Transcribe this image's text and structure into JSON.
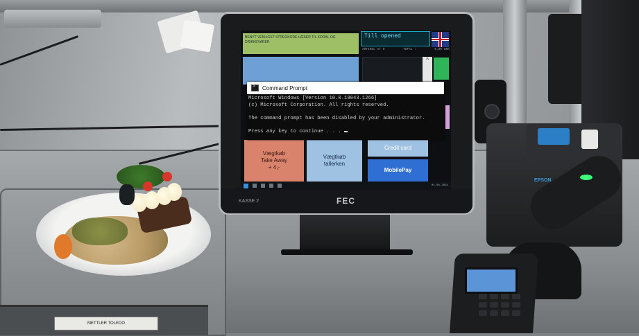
{
  "terminal": {
    "bezel_brand": "FEC",
    "register_label": "KASSE 2"
  },
  "pos": {
    "banner_text": "BENYT VENLIGST STREGKODE LÆSER TIL KODAL OG DRIKKEVARER",
    "till_status": "Till opened",
    "stats": [
      "ARTIKEL  Ar 0",
      "TOTAL :",
      "0,00 DKK"
    ],
    "scroll_arrow": "^",
    "buttons": {
      "takeaway": [
        "Vægtkøb",
        "Take Away",
        "+ 4,-"
      ],
      "tallerken": [
        "Vægtkøb",
        "tallerken"
      ],
      "credit": "Credit card",
      "mobilepay": "MobilePay"
    },
    "taskbar_clock": "01-05-2021"
  },
  "cmd": {
    "title": "Command Prompt",
    "lines": [
      "Microsoft Windows [Version 10.0.19043.1266]",
      "(c) Microsoft Corporation. All rights reserved.",
      "",
      "The command prompt has been disabled by your administrator.",
      "",
      "Press any key to continue . . . "
    ]
  },
  "scale": {
    "label": "METTLER TOLEDO"
  },
  "printer": {
    "brand": "EPSON"
  },
  "colors": {
    "takeaway": "#d9826c",
    "tallerken": "#9fc1e2",
    "mobilepay": "#2f6fd3",
    "cmd_bg": "#0c0c0c",
    "banner": "#9fbf66",
    "scanner_led": "#3dff7a"
  },
  "icons": [
    "cmd-icon",
    "uk-flag-icon",
    "windows-start-icon"
  ]
}
